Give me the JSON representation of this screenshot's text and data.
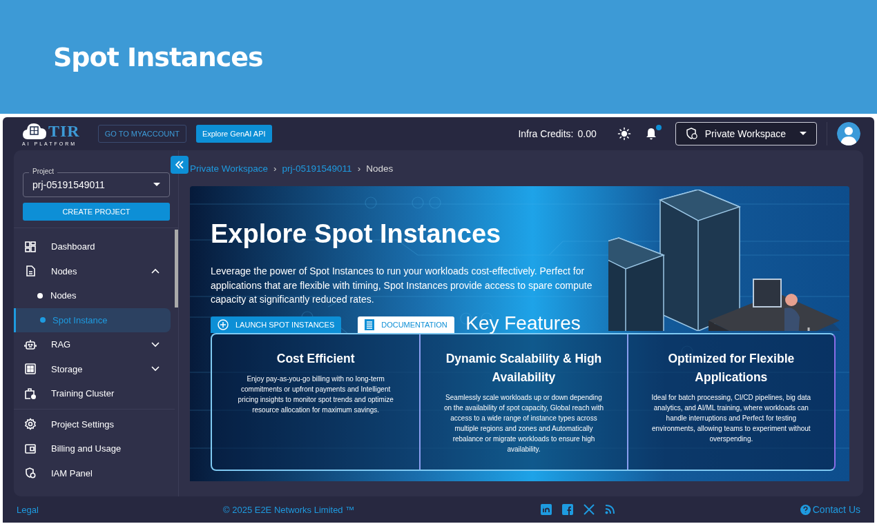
{
  "page_title": "Spot Instances",
  "topbar": {
    "logo": {
      "name": "TIR",
      "subtitle": "AI PLATFORM"
    },
    "buttons": [
      {
        "label": "GO TO MYACCOUNT",
        "kind": "outline"
      },
      {
        "label": "Explore GenAI API",
        "kind": "filled"
      }
    ],
    "credits_label": "Infra Credits:",
    "credits_value": "0.00",
    "has_unread": true,
    "workspace": "Private Workspace"
  },
  "sidebar": {
    "project_label": "Project",
    "project_value": "prj-05191549011",
    "create_button": "CREATE PROJECT",
    "groups": [
      [
        {
          "label": "Dashboard",
          "kind": "dashboard",
          "selected": false
        },
        {
          "label": "Nodes",
          "kind": "document",
          "selected": false,
          "expanded": true,
          "children": [
            {
              "label": "Nodes",
              "selected": false
            },
            {
              "label": "Spot Instance",
              "selected": true
            }
          ]
        },
        {
          "label": "RAG",
          "kind": "robot",
          "selected": false,
          "expanded": false
        },
        {
          "label": "Storage",
          "kind": "storage",
          "selected": false,
          "expanded": false
        },
        {
          "label": "Training Cluster",
          "kind": "cluster",
          "selected": false
        }
      ],
      [
        {
          "label": "Project Settings",
          "kind": "gear",
          "selected": false
        },
        {
          "label": "Billing and Usage",
          "kind": "wallet",
          "selected": false
        },
        {
          "label": "IAM Panel",
          "kind": "shield",
          "selected": false
        }
      ]
    ]
  },
  "breadcrumb": {
    "items": [
      "Private Workspace",
      "prj-05191549011",
      "Nodes"
    ],
    "separators": [
      "›",
      "›"
    ]
  },
  "banner": {
    "title": "Explore Spot Instances",
    "description": "Leverage the power of Spot Instances to run your workloads cost-effectively. Perfect for applications that are flexible with timing, Spot Instances provide access to spare compute capacity at significantly reduced rates.",
    "buttons": [
      {
        "label": "LAUNCH SPOT INSTANCES",
        "kind": "launch"
      },
      {
        "label": "DOCUMENTATION",
        "kind": "docs"
      }
    ],
    "features_heading": "Key Features",
    "features": [
      {
        "title": "Cost Efficient",
        "text": "Enjoy pay-as-you-go billing with no long-term commitments or upfront payments and Intelligent pricing insights to monitor spot trends and optimize resource allocation for maximum savings."
      },
      {
        "title": "Dynamic Scalability & High Availability",
        "text": "Seamlessly scale workloads up or down depending on the availability of spot capacity, Global reach with access to a wide range of instance types across multiple regions and zones and Automatically rebalance or migrate workloads to ensure high availability."
      },
      {
        "title": "Optimized for Flexible Applications",
        "text": "Ideal for batch processing, CI/CD pipelines, big data analytics, and AI/ML training, where workloads can handle interruptions and Perfect for testing environments, allowing teams to experiment without overspending."
      }
    ]
  },
  "footer": {
    "legal": "Legal",
    "copyright": "© 2025 E2E Networks Limited ™",
    "contact": "Contact Us"
  }
}
